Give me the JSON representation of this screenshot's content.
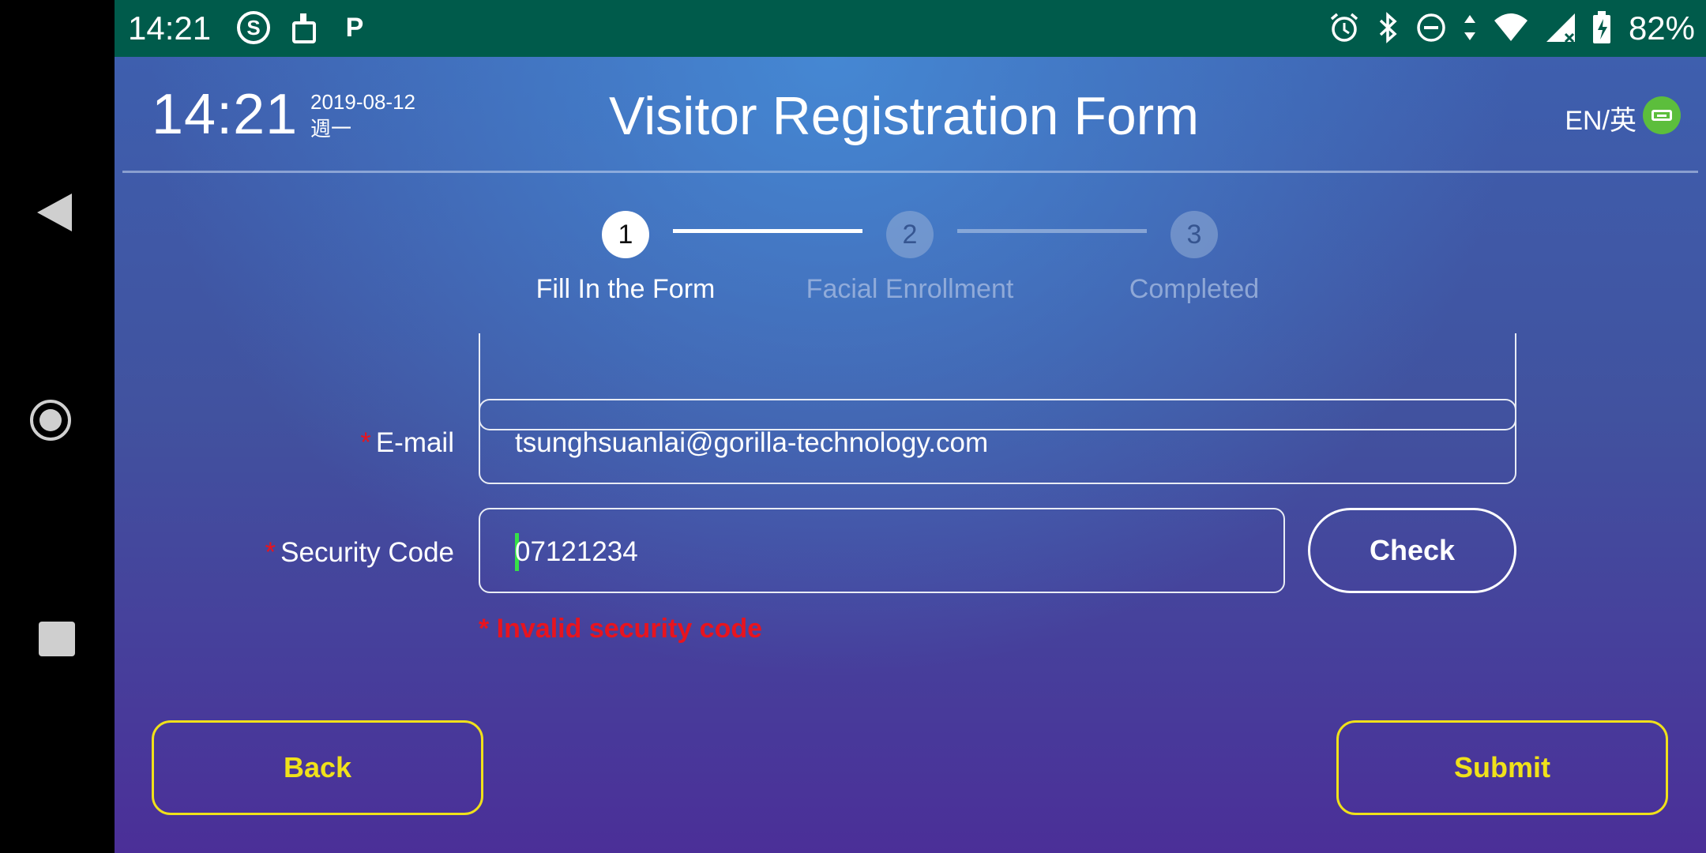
{
  "status_bar": {
    "time": "14:21",
    "battery_percent": "82%",
    "left_icons": [
      "s-circle-icon",
      "cleaner-icon",
      "p-icon"
    ],
    "right_icons": [
      "alarm-icon",
      "bluetooth-icon",
      "dnd-icon",
      "data-arrows-icon",
      "wifi-icon",
      "cellular-icon",
      "battery-charging-icon"
    ]
  },
  "header": {
    "time": "14:21",
    "date": "2019-08-12",
    "weekday": "週一",
    "title": "Visitor Registration Form",
    "language": "EN/英"
  },
  "stepper": {
    "current_step": 1,
    "steps": [
      {
        "number": "1",
        "label": "Fill In the Form"
      },
      {
        "number": "2",
        "label": "Facial Enrollment"
      },
      {
        "number": "3",
        "label": "Completed"
      }
    ]
  },
  "form": {
    "email": {
      "label": "E-mail",
      "required": "*",
      "value": "tsunghsuanlai@gorilla-technology.com"
    },
    "security_code": {
      "label": "Security Code",
      "required": "*",
      "value": "07121234"
    },
    "check_button": "Check",
    "error": "* Invalid security code"
  },
  "actions": {
    "back": "Back",
    "submit": "Submit"
  },
  "colors": {
    "status_bar": "#005b4b",
    "accent_yellow": "#f0e11a",
    "error_red": "#e8141e",
    "language_icon": "#5cbe3c",
    "cursor": "#36e048"
  }
}
